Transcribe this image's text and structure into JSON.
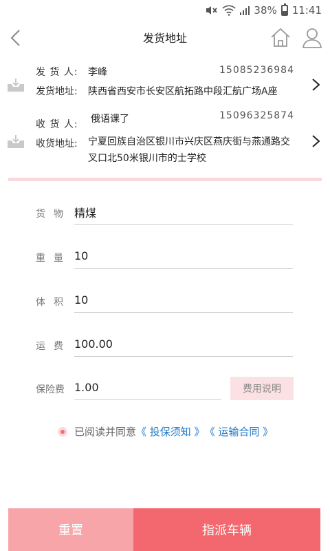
{
  "status_bar": {
    "battery": "38%",
    "time": "11:41",
    "icons": [
      "mute-icon",
      "wifi-icon",
      "signal-icon",
      "battery-icon"
    ]
  },
  "nav": {
    "title": "发货地址",
    "icons": [
      "back-icon",
      "home-icon",
      "user-icon"
    ]
  },
  "sender": {
    "name_label": "发 货 人:",
    "name": "李峰",
    "phone": "15085236984",
    "address_label": "发货地址:",
    "address": "陕西省西安市长安区航拓路中段汇航广场A座"
  },
  "receiver": {
    "name_label": "收 货 人:",
    "name": "俄语课了",
    "phone": "15096325874",
    "address_label": "收货地址:",
    "address": "宁夏回族自治区银川市兴庆区燕庆街与燕通路交叉口北50米银川市的士学校"
  },
  "form": {
    "cargo_label": "货物",
    "cargo_value": "精煤",
    "weight_label": "重量",
    "weight_value": "10",
    "volume_label": "体积",
    "volume_value": "10",
    "freight_label": "运费",
    "freight_value": "100.00",
    "insurance_label": "保险费",
    "insurance_value": "1.00",
    "fee_info_button": "费用说明"
  },
  "agreement": {
    "prefix": "已阅读并同意",
    "link1": "《 投保须知 》",
    "link2": "《 运输合同 》"
  },
  "actions": {
    "reset": "重置",
    "dispatch": "指派车辆"
  },
  "colors": {
    "accent": "#f3686e",
    "accent_light": "#f7a5a9",
    "divider": "#f9d9dc",
    "link": "#1f7ac7"
  }
}
